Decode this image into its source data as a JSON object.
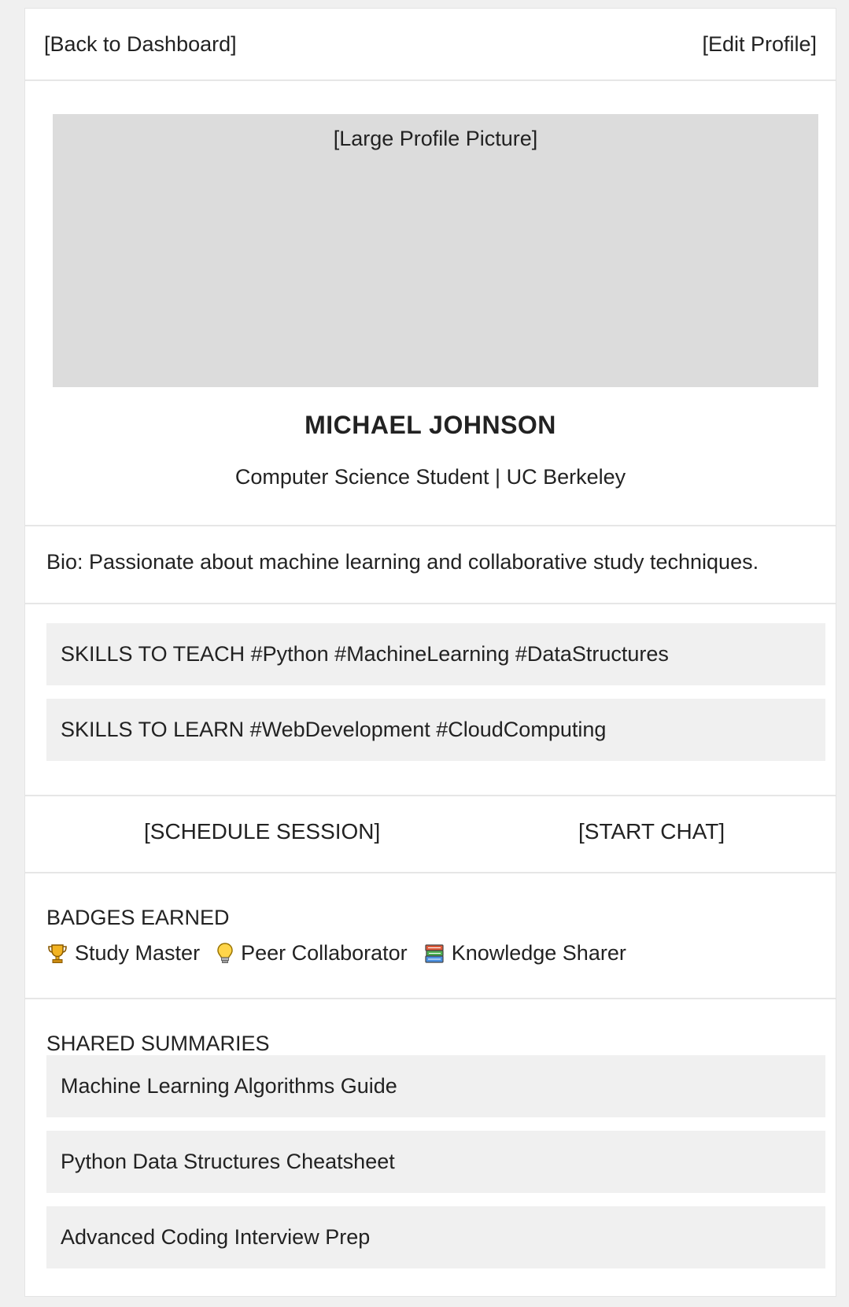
{
  "header": {
    "back_label": "[Back to Dashboard]",
    "edit_label": "[Edit Profile]"
  },
  "profile": {
    "photo_placeholder": "[Large Profile Picture]",
    "name": "MICHAEL JOHNSON",
    "subtitle": "Computer Science Student | UC Berkeley",
    "bio": "Bio: Passionate about machine learning and collaborative study techniques."
  },
  "skills": {
    "teach": "SKILLS TO TEACH #Python #MachineLearning #DataStructures",
    "learn": "SKILLS TO LEARN #WebDevelopment #CloudComputing"
  },
  "actions": {
    "schedule_label": "[SCHEDULE SESSION]",
    "chat_label": "[START CHAT]"
  },
  "badges": {
    "heading": "BADGES EARNED",
    "items": [
      {
        "icon": "trophy-icon",
        "label": "Study Master"
      },
      {
        "icon": "lightbulb-icon",
        "label": "Peer Collaborator"
      },
      {
        "icon": "books-icon",
        "label": "Knowledge Sharer"
      }
    ]
  },
  "summaries": {
    "heading": "SHARED SUMMARIES",
    "items": [
      "Machine Learning Algorithms Guide",
      "Python Data Structures Cheatsheet",
      "Advanced Coding Interview Prep"
    ]
  },
  "colors": {
    "page_background": "#f0f0f0",
    "card_background": "#ffffff",
    "placeholder_gray": "#dcdcdc",
    "box_gray": "#f0f0f0",
    "divider": "#e6e6e6",
    "text": "#222222"
  }
}
